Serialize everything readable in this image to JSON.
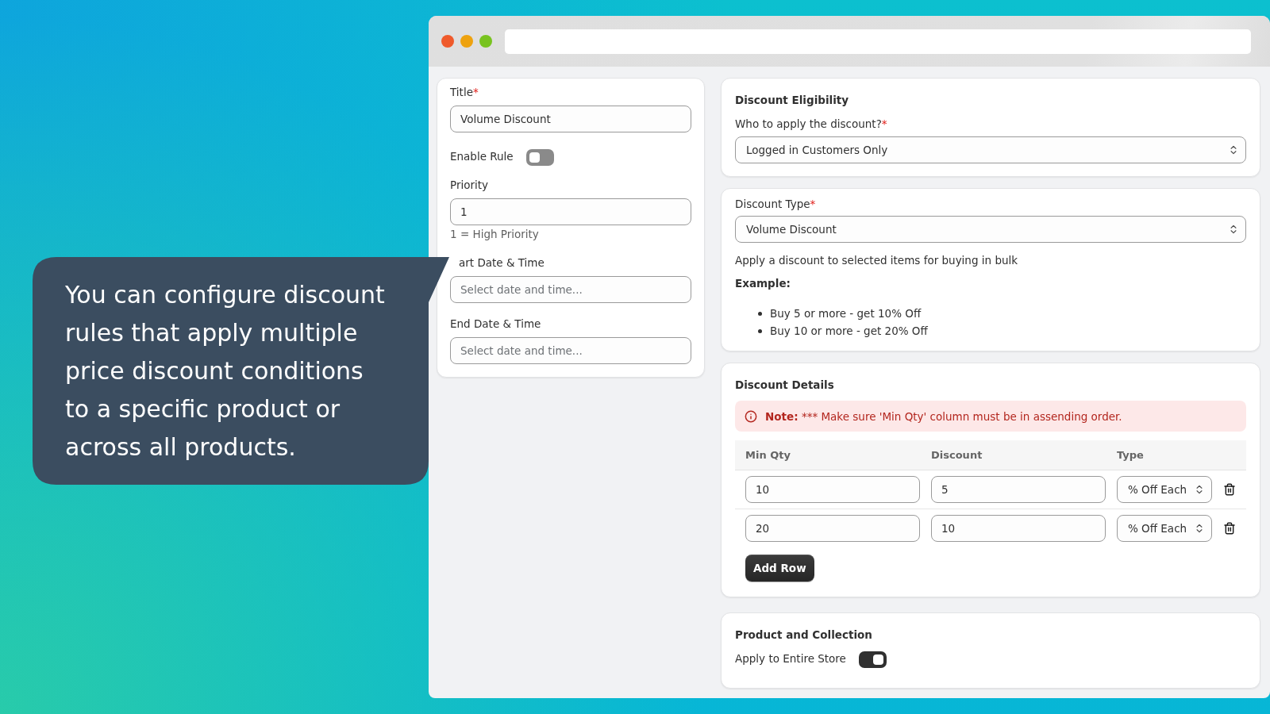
{
  "callout": {
    "text": "You can configure discount rules that apply multiple price discount conditions to a specific product or across all products."
  },
  "rule_form": {
    "fields": [
      {
        "kind": "text",
        "label": "Title",
        "required_mark": "*",
        "value": "Volume Discount"
      },
      {
        "kind": "toggle",
        "label": "Enable Rule",
        "on": false
      },
      {
        "kind": "text",
        "label": "Priority",
        "value": "1",
        "help": "1 = High Priority"
      },
      {
        "kind": "text",
        "label": "art Date & Time",
        "placeholder": "Select date and time..."
      },
      {
        "kind": "text",
        "label": "End Date & Time",
        "placeholder": "Select date and time..."
      }
    ]
  },
  "eligibility": {
    "heading": "Discount Eligibility",
    "label": "Who to apply the discount?",
    "required_mark": "*",
    "value": "Logged in Customers Only"
  },
  "discount_type": {
    "label": "Discount Type",
    "required_mark": "*",
    "value": "Volume Discount",
    "description": "Apply a discount to selected items for buying in bulk",
    "example_heading": "Example:",
    "examples": [
      "Buy 5 or more - get 10% Off",
      "Buy 10 or more - get 20% Off"
    ]
  },
  "discount_details": {
    "heading": "Discount Details",
    "note": {
      "lead": "Note:",
      "text": "*** Make sure 'Min Qty' column must be in assending order."
    },
    "columns": [
      "Min Qty",
      "Discount",
      "Type"
    ],
    "rows": [
      {
        "min_qty": "10",
        "discount": "5",
        "type": "% Off Each"
      },
      {
        "min_qty": "20",
        "discount": "10",
        "type": "% Off Each"
      }
    ],
    "add_row": "Add Row"
  },
  "product_collection": {
    "heading": "Product and Collection",
    "toggle": {
      "label": "Apply to Entire Store",
      "on": true
    }
  }
}
